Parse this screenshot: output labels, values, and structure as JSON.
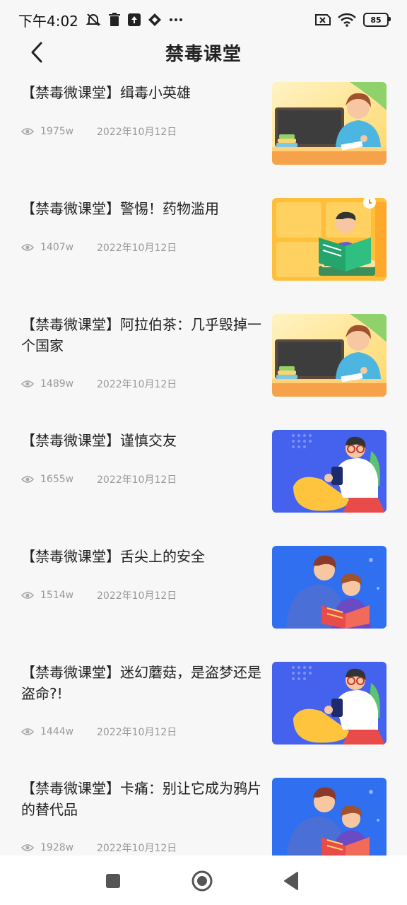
{
  "status": {
    "time": "下午4:02",
    "battery": "85"
  },
  "header": {
    "title": "禁毒课堂"
  },
  "articles": [
    {
      "title": "【禁毒微课堂】缉毒小英雄",
      "views": "1975w",
      "date": "2022年10月12日",
      "thumb": "classroom-illustration"
    },
    {
      "title": "【禁毒微课堂】警惕！药物滥用",
      "views": "1407w",
      "date": "2022年10月12日",
      "thumb": "reading-boy-illustration"
    },
    {
      "title": "【禁毒微课堂】阿拉伯茶：几乎毁掉一个国家",
      "views": "1489w",
      "date": "2022年10月12日",
      "thumb": "classroom-illustration"
    },
    {
      "title": "【禁毒微课堂】谨慎交友",
      "views": "1655w",
      "date": "2022年10月12日",
      "thumb": "phone-man-illustration"
    },
    {
      "title": "【禁毒微课堂】舌尖上的安全",
      "views": "1514w",
      "date": "2022年10月12日",
      "thumb": "family-reading-illustration"
    },
    {
      "title": "【禁毒微课堂】迷幻蘑菇，是盗梦还是盗命?!",
      "views": "1444w",
      "date": "2022年10月12日",
      "thumb": "phone-man-illustration"
    },
    {
      "title": "【禁毒微课堂】卡痛：别让它成为鸦片的替代品",
      "views": "1928w",
      "date": "2022年10月12日",
      "thumb": "family-reading-illustration"
    }
  ]
}
